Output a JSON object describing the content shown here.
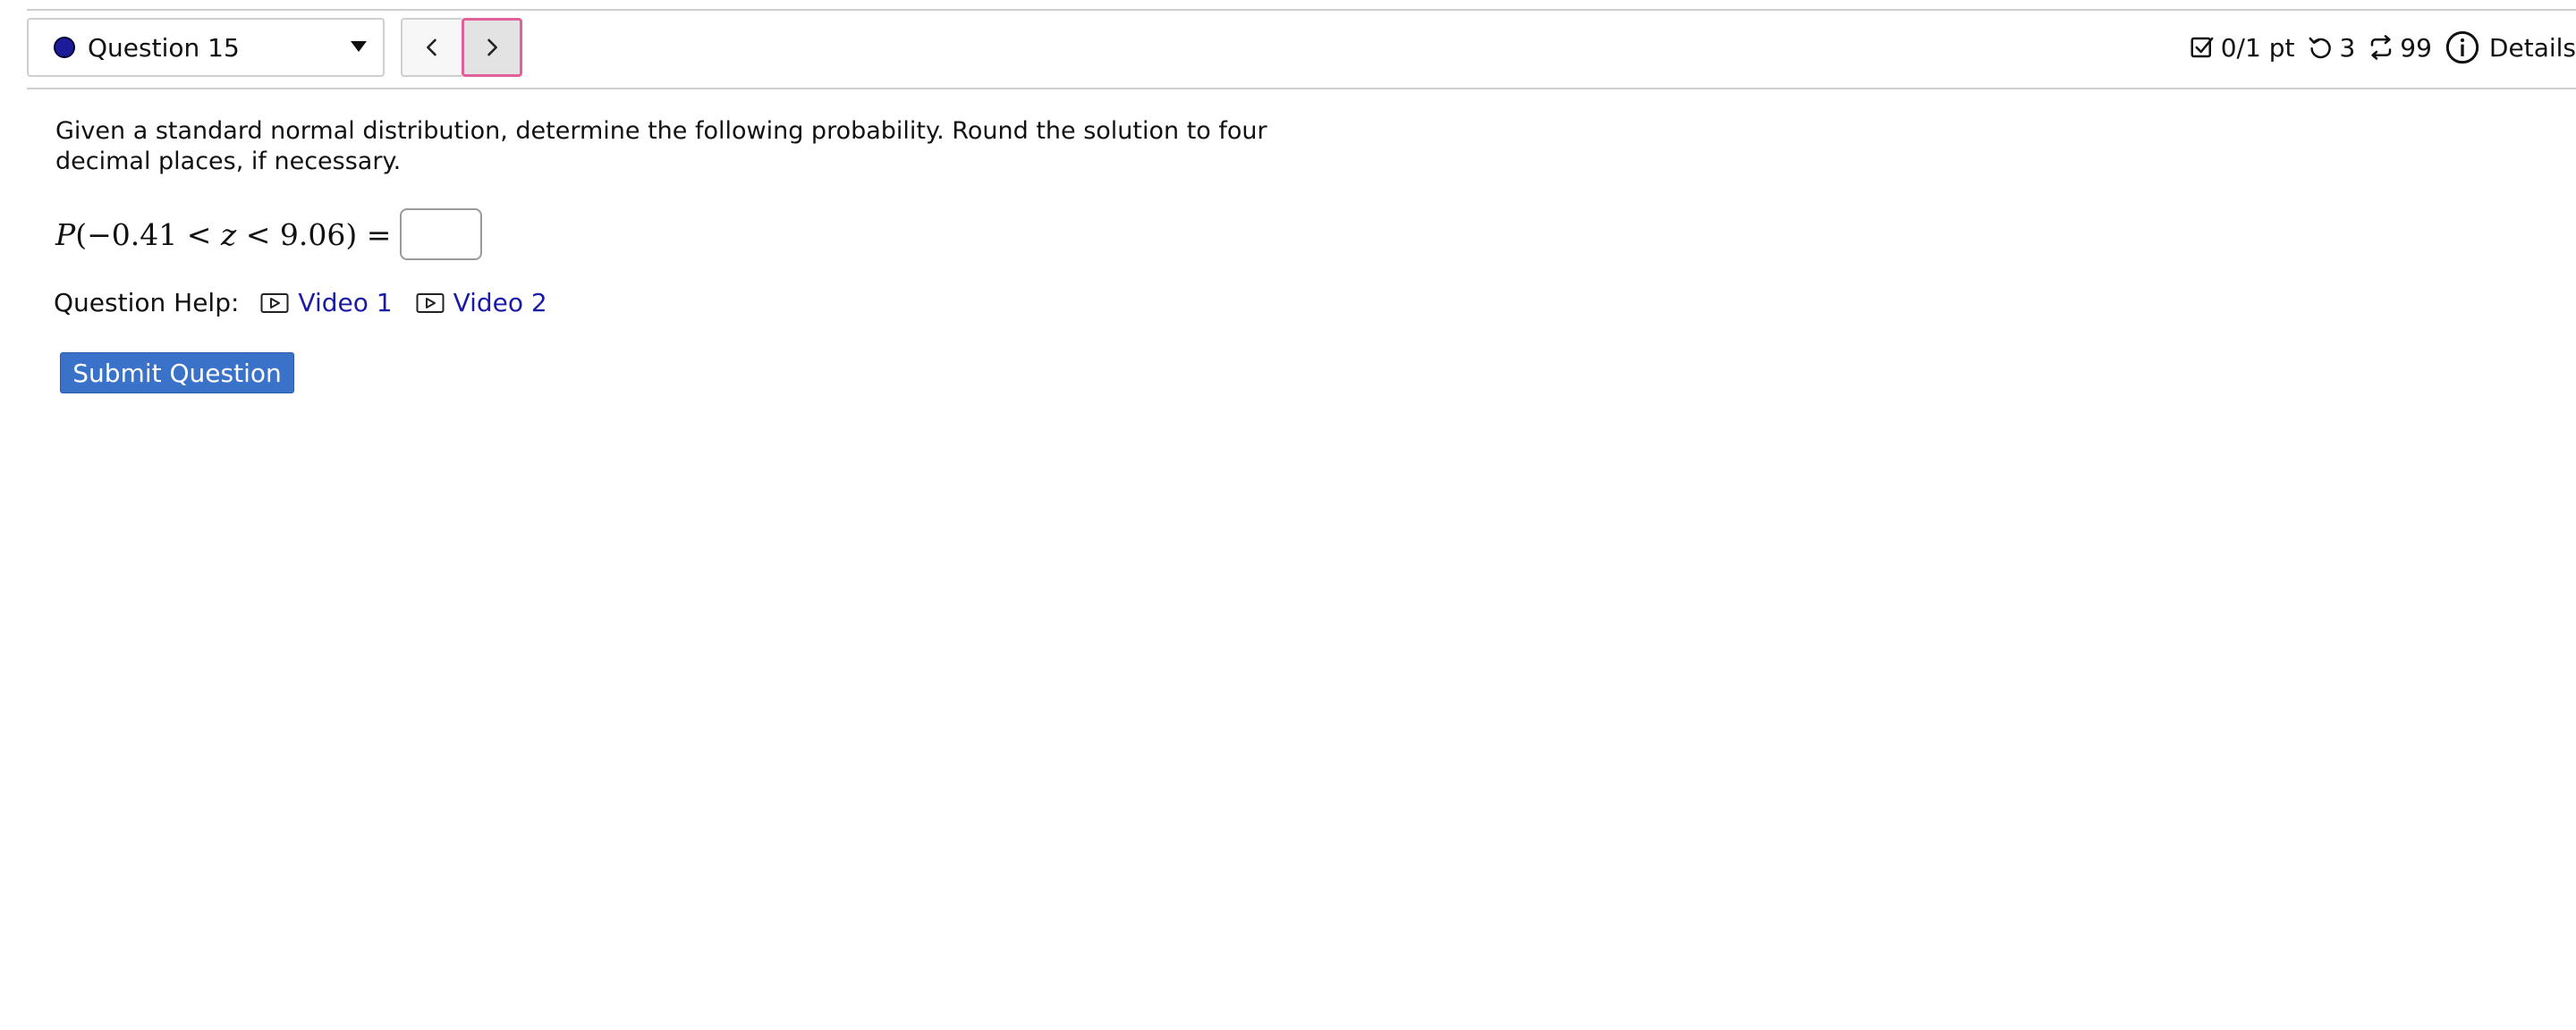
{
  "header": {
    "question_selector": {
      "label": "Question 15",
      "status_color": "#1c1c9a"
    },
    "nav": {
      "prev_icon": "chevron-left-icon",
      "next_icon": "chevron-right-icon"
    },
    "status": {
      "score": "0/1 pt",
      "retries": "3",
      "attempts": "99",
      "details_label": "Details"
    }
  },
  "question": {
    "prompt": "Given a standard normal distribution, determine the following probability. Round the solution to four decimal places, if necessary.",
    "expression": {
      "fn": "P",
      "open": "(",
      "lower": "−0.41",
      "lt1": " < ",
      "var": "z",
      "lt2": " < ",
      "upper": "9.06",
      "close": ")",
      "eq": " ="
    },
    "answer_value": "",
    "help": {
      "label": "Question Help:",
      "links": [
        {
          "label": "Video 1"
        },
        {
          "label": "Video 2"
        }
      ]
    },
    "submit_label": "Submit Question"
  },
  "colors": {
    "link": "#1a1aa6",
    "submit_bg": "#3a72c9",
    "focus_ring": "#e0609a"
  }
}
